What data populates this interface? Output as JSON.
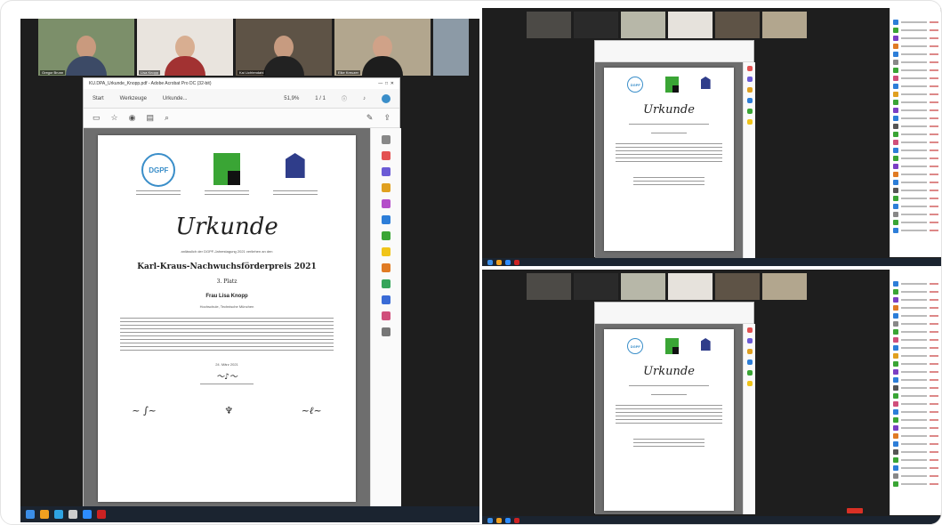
{
  "main": {
    "participants": [
      {
        "name": "Gregor Brunn"
      },
      {
        "name": "Lisa Knopp"
      },
      {
        "name": "Kai Lichtendahl"
      },
      {
        "name": "Elke Kreuzer"
      }
    ],
    "window_title": "KU.DPA_Urkunde_Knopp.pdf - Adobe Acrobat Pro DC (32-bit)",
    "menu": [
      "Start",
      "Werkzeuge",
      "Urkunde..."
    ],
    "page_indicator": "1 / 1",
    "zoom": "51,9%",
    "certificate": {
      "logo1": "DGPF",
      "title": "Urkunde",
      "intro": "anlässlich der DGPF-Jahrestagung 2021 verliehen an den",
      "prize": "Karl-Kraus-Nachwuchsförderpreis 2021",
      "place": "3. Platz",
      "recipient": "Frau Lisa Knopp",
      "affiliation": "Hochschule, Technische München",
      "date": "24. März 2021"
    }
  },
  "colors": {
    "accent_blue": "#3a8ec9",
    "logo_green": "#3aa535",
    "logo_navy": "#2f3d8a",
    "meeting_bg": "#1e1e1e",
    "taskbar": "#1b2430"
  }
}
